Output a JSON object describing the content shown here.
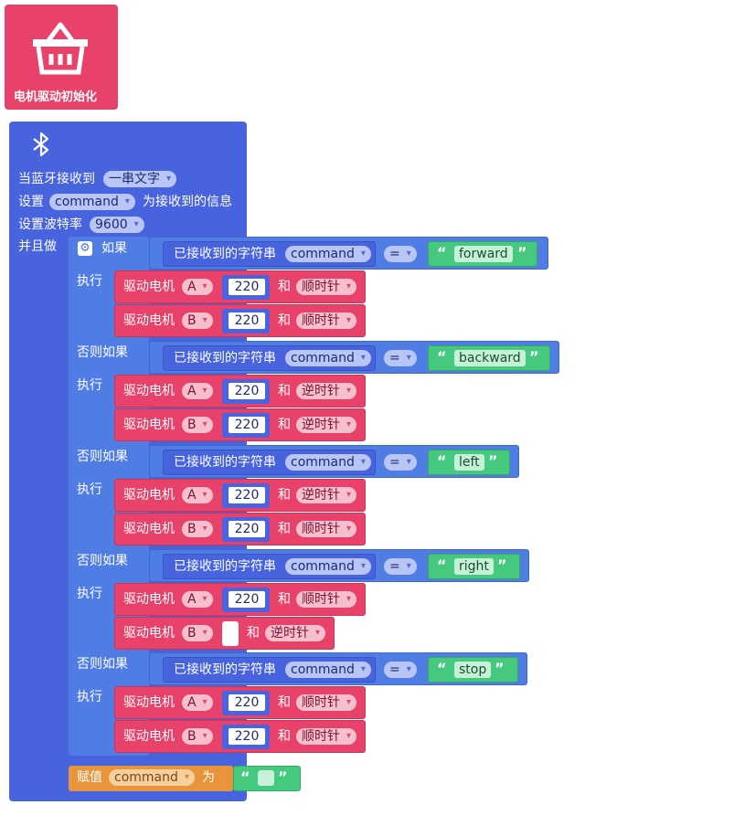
{
  "init_block": {
    "label": "电机驱动初始化",
    "icon": "basket-icon"
  },
  "bluetooth_block": {
    "icon": "bluetooth-icon",
    "receive_label": "当蓝牙接收到",
    "receive_type": "一串文字",
    "set_label": "设置",
    "set_var": "command",
    "set_suffix": "为接收到的信息",
    "baud_label": "设置波特率",
    "baud_value": "9600",
    "do_label": "并且做"
  },
  "if_block": {
    "if_label": "如果",
    "elseif_label": "否则如果",
    "do_label": "执行"
  },
  "conditions": [
    {
      "label": "已接收到的字符串",
      "var": "command",
      "op": "=",
      "value": "forward"
    },
    {
      "label": "已接收到的字符串",
      "var": "command",
      "op": "=",
      "value": "backward"
    },
    {
      "label": "已接收到的字符串",
      "var": "command",
      "op": "=",
      "value": "left"
    },
    {
      "label": "已接收到的字符串",
      "var": "command",
      "op": "=",
      "value": "right"
    },
    {
      "label": "已接收到的字符串",
      "var": "command",
      "op": "=",
      "value": "stop"
    }
  ],
  "motor_label": "驱动电机",
  "and_label": "和",
  "motors": [
    {
      "motor": "A",
      "speed": "220",
      "dir": "顺时针"
    },
    {
      "motor": "B",
      "speed": "220",
      "dir": "顺时针"
    },
    {
      "motor": "A",
      "speed": "220",
      "dir": "逆时针"
    },
    {
      "motor": "B",
      "speed": "220",
      "dir": "逆时针"
    },
    {
      "motor": "A",
      "speed": "220",
      "dir": "逆时针"
    },
    {
      "motor": "B",
      "speed": "220",
      "dir": "顺时针"
    },
    {
      "motor": "A",
      "speed": "220",
      "dir": "顺时针"
    },
    {
      "motor": "B",
      "speed": "",
      "dir": "逆时针"
    },
    {
      "motor": "A",
      "speed": "220",
      "dir": "顺时针"
    },
    {
      "motor": "B",
      "speed": "220",
      "dir": "顺时针"
    }
  ],
  "assign_block": {
    "label": "赋值",
    "var": "command",
    "to_label": "为",
    "value": ""
  },
  "quote_open": "“",
  "quote_close": "”",
  "colors": {
    "motor_red": "#e8426b",
    "event_blue": "#4863de",
    "control_blue": "#4f7de3",
    "string_green": "#45c97f",
    "variable_orange": "#e8943a"
  }
}
